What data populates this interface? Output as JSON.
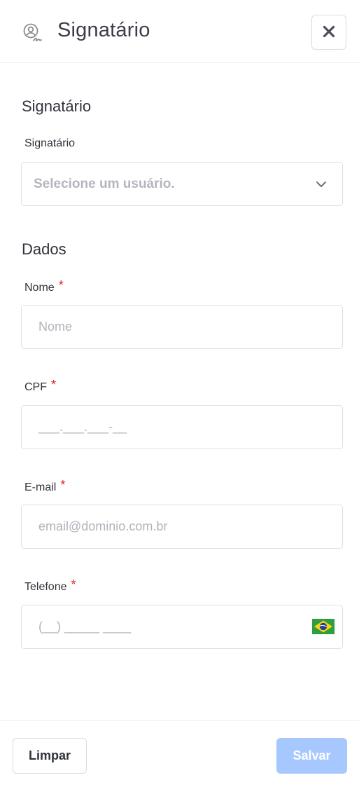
{
  "header": {
    "title": "Signatário",
    "icon": "signature-user-icon",
    "close_icon": "close-icon"
  },
  "signatory_section": {
    "title": "Signatário",
    "field_label": "Signatário",
    "select_placeholder": "Selecione um usuário.",
    "select_icon": "chevron-down-icon"
  },
  "data_section": {
    "title": "Dados",
    "required_marker": "*",
    "fields": {
      "name": {
        "label": "Nome",
        "placeholder": "Nome"
      },
      "cpf": {
        "label": "CPF",
        "placeholder": "___.___.___-__"
      },
      "email": {
        "label": "E-mail",
        "placeholder": "email@dominio.com.br"
      },
      "phone": {
        "label": "Telefone",
        "placeholder": "(__) _____ ____",
        "flag_icon": "brazil-flag-icon"
      }
    }
  },
  "footer": {
    "clear_label": "Limpar",
    "save_label": "Salvar",
    "save_color": "#a7c8ff"
  }
}
